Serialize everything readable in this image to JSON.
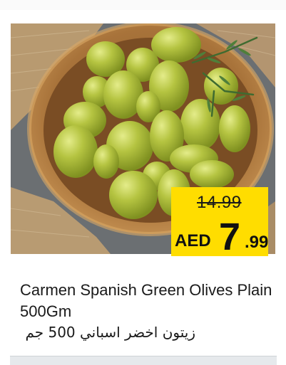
{
  "product": {
    "name_en": "Carmen Spanish Green Olives Plain 500Gm",
    "name_ar": "زيتون اخضر اسباني 500 جم",
    "image_icon": "green-olives-bowl-photo"
  },
  "price": {
    "old_price": "14.99",
    "currency": "AED",
    "integer": "7",
    "decimal": ".99"
  },
  "colors": {
    "price_box": "#ffdd00",
    "olive": "#a7b936",
    "bowl": "#b07a3e",
    "background": "#6e7377"
  }
}
